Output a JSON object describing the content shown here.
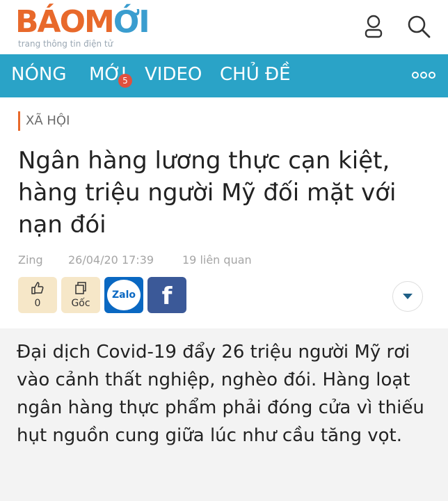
{
  "brand": {
    "logo_text_1": "BÁOM",
    "logo_text_2": "ỚI",
    "tagline": "trang thông tin điện tử"
  },
  "header_icons": [
    "user-icon",
    "search-icon"
  ],
  "nav": {
    "items": [
      "NÓNG",
      "MỚI",
      "VIDEO",
      "CHỦ ĐỀ"
    ],
    "badge": "5",
    "more_icon": "more-dots-icon"
  },
  "article": {
    "category": "XÃ HỘI",
    "title": "Ngân hàng lương thực cạn kiệt, hàng triệu người Mỹ đối mặt với nạn đói",
    "source": "Zing",
    "datetime": "26/04/20 17:39",
    "related": "19 liên quan",
    "like_count": "0",
    "source_button": "Gốc",
    "zalo_label": "Zalo",
    "facebook_label": "f",
    "sapo": "Đại dịch Covid-19 đẩy 26 triệu người Mỹ rơi vào cảnh thất nghiệp, nghèo đói. Hàng loạt ngân hàng thực phẩm phải đóng cửa vì thiếu hụt nguồn cung giữa lúc như cầu tăng vọt."
  },
  "colors": {
    "brand_orange": "#e8692b",
    "brand_blue": "#3a9dcf",
    "nav_bg": "#2aa3c7",
    "zalo": "#0a68c2",
    "facebook": "#3b5998",
    "action_bg": "#f6e7c8"
  }
}
